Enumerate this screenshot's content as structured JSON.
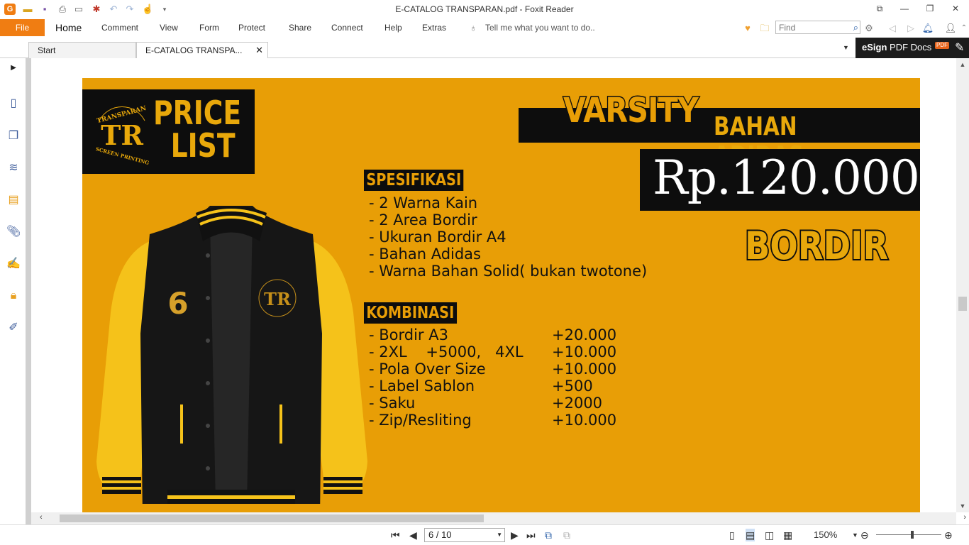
{
  "window": {
    "title": "E-CATALOG TRANSPARAN.pdf - Foxit Reader",
    "controls": [
      "⧉",
      "—",
      "❐",
      "✕"
    ]
  },
  "quick_access": [
    "app-logo-icon",
    "open-icon",
    "save-icon",
    "print-icon",
    "screenshot-icon",
    "new-icon",
    "undo-icon",
    "redo-icon",
    "hand-tool-icon",
    "customize-icon"
  ],
  "ribbon": {
    "file": "File",
    "tabs": [
      "Home",
      "Comment",
      "View",
      "Form",
      "Protect",
      "Share",
      "Connect",
      "Help",
      "Extras"
    ],
    "tell_me": "Tell me what you want to do..",
    "find_placeholder": "Find"
  },
  "doc_tabs": {
    "start": "Start",
    "active": "E-CATALOG TRANSPA...",
    "close": "✕"
  },
  "esign": {
    "brand": "eSign",
    "rest": " PDF Docs",
    "badge": "PDF"
  },
  "page": {
    "price_list": [
      "PRICE",
      "LIST"
    ],
    "logo_top": "TRANSPARAN",
    "logo_bottom": "SCREEN PRINTING",
    "logo_mark": "TR",
    "title_main": "VARSITY",
    "title_sub": "BAHAN ADIDAS",
    "price": "Rp.120.000",
    "badge": "BORDIR",
    "spec_title": "SPESIFIKASI",
    "specs": [
      "- 2 Warna Kain",
      "- 2 Area Bordir",
      "- Ukuran Bordir A4",
      "- Bahan Adidas",
      "- Warna Bahan Solid( bukan twotone)"
    ],
    "komb_title": "KOMBINASI",
    "kombinasi": [
      {
        "label": "- Bordir A3",
        "value": "+20.000"
      },
      {
        "label": "- 2XL    +5000,   4XL",
        "value": "+10.000"
      },
      {
        "label": "- Pola Over Size",
        "value": "+10.000"
      },
      {
        "label": "- Label Sablon",
        "value": "+500"
      },
      {
        "label": "- Saku",
        "value": "+2000"
      },
      {
        "label": "- Zip/Resliting",
        "value": "+10.000"
      }
    ],
    "jacket_number": "6",
    "colors": {
      "background": "#e89e06",
      "black": "#0d0d0d",
      "yellow": "#f5c21a"
    }
  },
  "status": {
    "page_indicator": "6 / 10",
    "zoom": "150%"
  }
}
